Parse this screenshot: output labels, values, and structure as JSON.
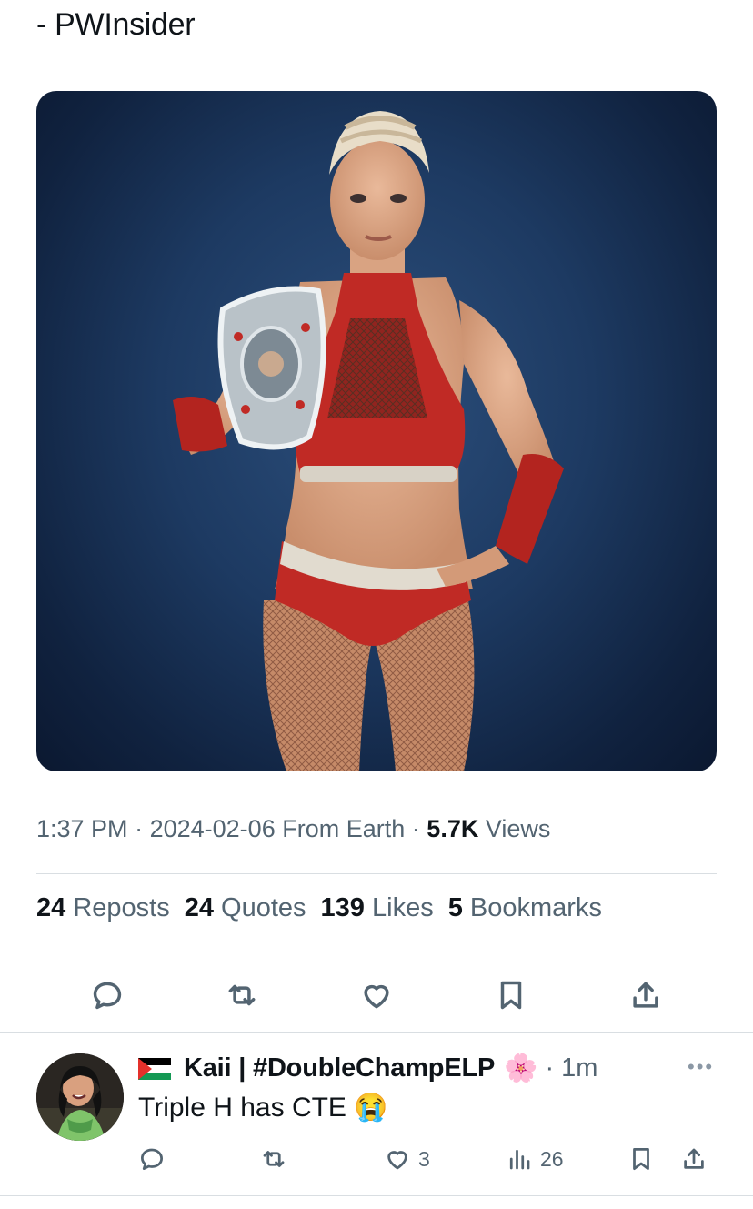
{
  "tweet": {
    "source_line": "- PWInsider",
    "meta": {
      "time": "1:37 PM",
      "date": "2024-02-06",
      "location": "From Earth",
      "views_count": "5.7K",
      "views_label": "Views",
      "sep": "·"
    },
    "stats": [
      {
        "count": "24",
        "label": "Reposts"
      },
      {
        "count": "24",
        "label": "Quotes"
      },
      {
        "count": "139",
        "label": "Likes"
      },
      {
        "count": "5",
        "label": "Bookmarks"
      }
    ],
    "actions": [
      "reply-icon",
      "repost-icon",
      "like-icon",
      "bookmark-icon",
      "share-icon"
    ]
  },
  "reply": {
    "flag": "palestine-flag-icon",
    "name": "Kaii | #DoubleChampELP",
    "badge_emoji": "🌸",
    "time": "· 1m",
    "more": "•••",
    "text": "Triple H has CTE",
    "text_emoji": "😭",
    "likes": "3",
    "views": "26"
  },
  "colors": {
    "text": "#0f1419",
    "muted": "#536471",
    "divider": "#d9dee2",
    "media_bg": "#1d3a62"
  }
}
